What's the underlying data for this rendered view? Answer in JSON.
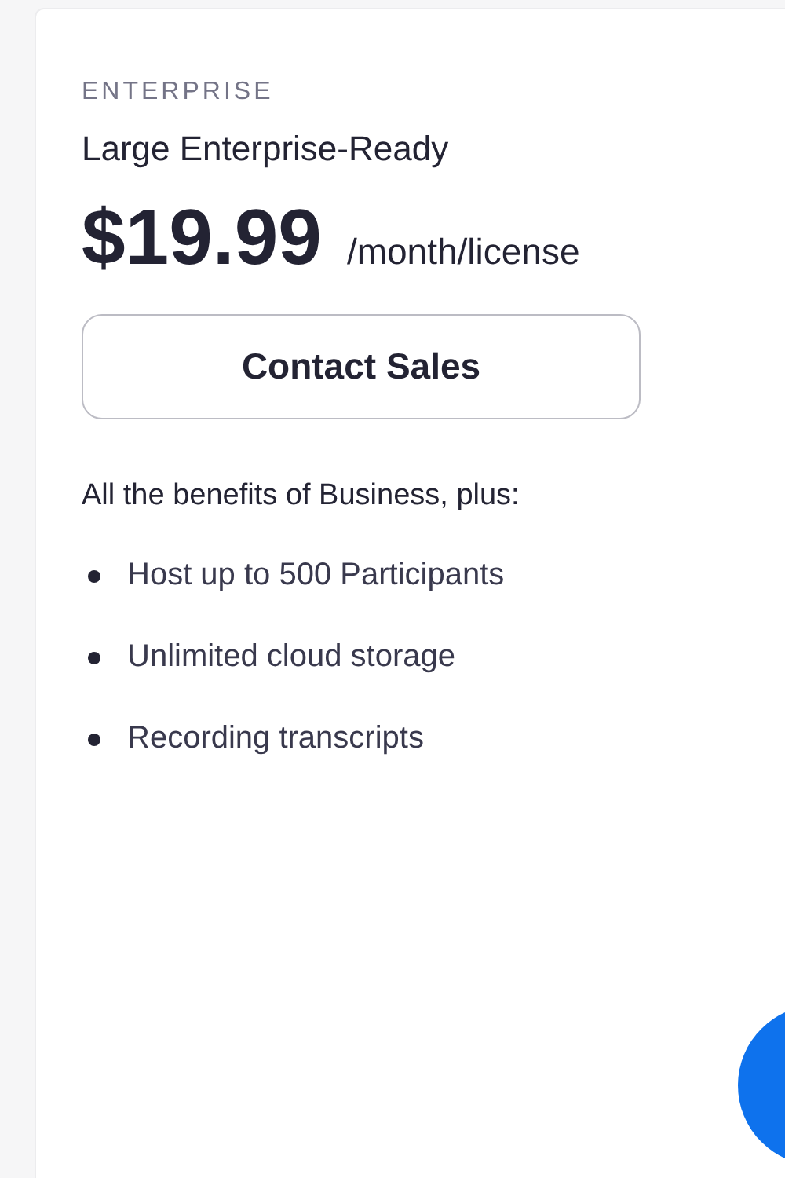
{
  "plan": {
    "tier": "ENTERPRISE",
    "subtitle": "Large Enterprise-Ready",
    "price": "$19.99",
    "period": "/month/license",
    "button": "Contact Sales",
    "intro": "All the benefits of Business, plus:",
    "features": [
      "Host up to 500 Participants",
      "Unlimited cloud storage",
      "Recording transcripts"
    ]
  }
}
